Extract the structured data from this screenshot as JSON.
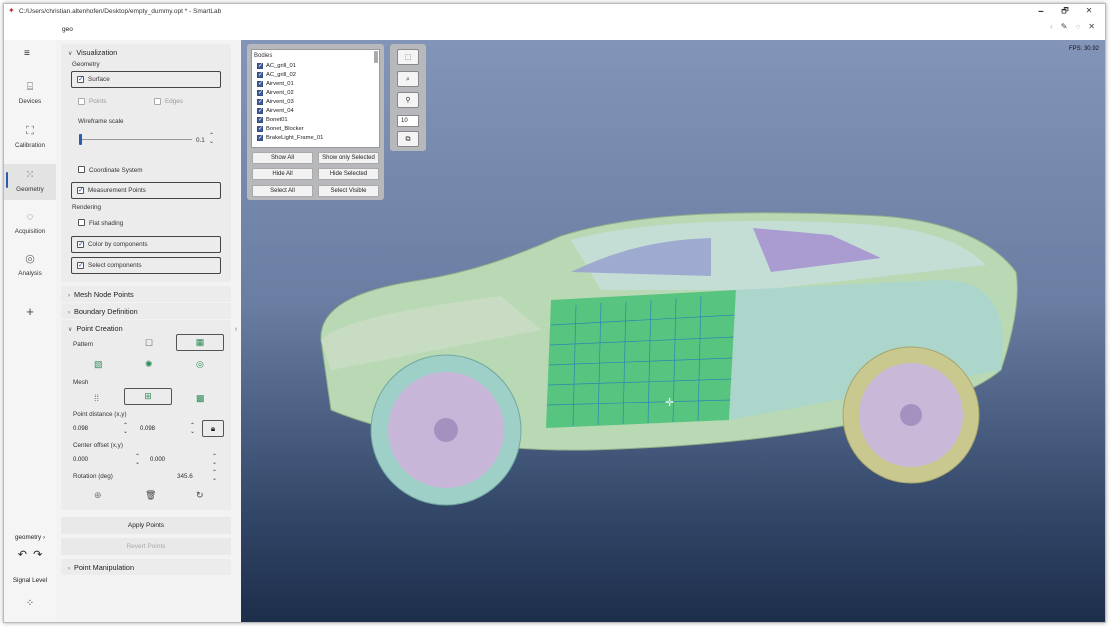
{
  "window": {
    "title": "C:/Users/christian.altenhofen/Desktop/empty_dummy.opt * - SmartLab",
    "controls": {
      "minimize": "🗕",
      "maximize": "🗗",
      "close": "✕"
    }
  },
  "header": {
    "tab": "geo"
  },
  "rail": {
    "items": [
      {
        "label": "Devices"
      },
      {
        "label": "Calibration"
      },
      {
        "label": "Geometry"
      },
      {
        "label": "Acquisition"
      },
      {
        "label": "Analysis"
      }
    ],
    "breadcrumb": "geometry",
    "signal_level": "Signal Level"
  },
  "visualization": {
    "title": "Visualization",
    "geometry_label": "Geometry",
    "surface": "Surface",
    "points": "Points",
    "edges": "Edges",
    "wireframe_label": "Wireframe scale",
    "wireframe_value": "0.1",
    "wireframe_fraction": 0.02,
    "coordinate_system": "Coordinate System",
    "measurement_points": "Measurement Points",
    "rendering_label": "Rendering",
    "flat_shading": "Flat shading",
    "color_by_components": "Color by components",
    "select_components": "Select components"
  },
  "sections": {
    "mesh_node_points": "Mesh Node Points",
    "boundary_definition": "Boundary Definition",
    "point_creation": "Point Creation",
    "point_manipulation": "Point Manipulation"
  },
  "point_creation": {
    "pattern_label": "Pattern",
    "mesh_label": "Mesh",
    "point_distance_label": "Point distance (x,y)",
    "dist_x": "0.098",
    "dist_y": "0.098",
    "center_offset_label": "Center offset (x,y)",
    "offset_x": "0.000",
    "offset_y": "0.000",
    "rotation_label": "Rotation (deg)",
    "rotation": "345.6",
    "apply": "Apply Points",
    "revert": "Revert Points"
  },
  "viewport": {
    "fps": "FPS: 30.92",
    "bodies_header": "Bodies",
    "bodies": [
      "AC_grill_01",
      "AC_grill_02",
      "Airvent_01",
      "Airvent_02",
      "Airvent_03",
      "Airvent_04",
      "Bonet01",
      "Bonet_Blocker",
      "BrakeLight_Frame_01"
    ],
    "buttons": {
      "show_all": "Show All",
      "show_only_selected": "Show only Selected",
      "hide_all": "Hide All",
      "hide_selected": "Hide Selected",
      "select_all": "Select All",
      "select_visible": "Select Visible"
    },
    "spin_value": "10"
  },
  "colors": {
    "accent": "#2a5db0",
    "viewport_top": "#8295b8",
    "viewport_bottom": "#1c2d49",
    "car_body": "#b9d9b4",
    "mesh": "#3fbf73"
  }
}
